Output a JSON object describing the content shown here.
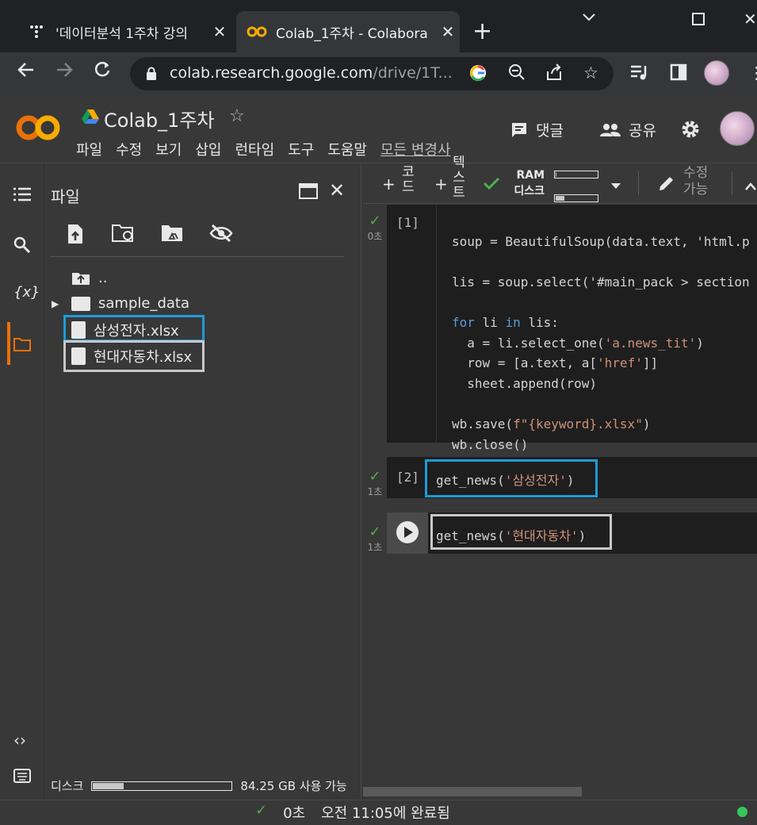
{
  "browser": {
    "tabs": [
      {
        "title": "'데이터분석 1주차 강의",
        "active": false
      },
      {
        "title": "Colab_1주차 - Colabora",
        "active": true
      }
    ],
    "url_host": "colab.research.google.com",
    "url_path": "/drive/1T..."
  },
  "colab": {
    "logo": "CO",
    "doc_title": "Colab_1주차",
    "menu": [
      "파일",
      "수정",
      "보기",
      "삽입",
      "런타임",
      "도구",
      "도움말",
      "모든 변경사"
    ],
    "comment_label": "댓글",
    "share_label": "공유"
  },
  "files_panel": {
    "title": "파일",
    "tree": [
      {
        "name": "..",
        "type": "parent"
      },
      {
        "name": "sample_data",
        "type": "folder"
      },
      {
        "name": "삼성전자.xlsx",
        "type": "file"
      },
      {
        "name": "현대자동차.xlsx",
        "type": "file"
      }
    ],
    "disk_label": "디스크",
    "disk_available": "84.25 GB 사용 가능",
    "disk_used_fraction": 0.22
  },
  "notebook_toolbar": {
    "add_code": "코드",
    "add_text": "텍스트",
    "ram_label": "RAM",
    "disk_label": "디스크",
    "ram_fraction": 0.02,
    "disk_fraction": 0.2,
    "edit_label": "수정 가능"
  },
  "cells": [
    {
      "prompt": "[1]",
      "status": "0초",
      "code": [
        "soup = BeautifulSoup(data.text, 'html.p",
        "",
        "lis = soup.select('#main_pack > section",
        "",
        "for li in lis:",
        "  a = li.select_one('a.news_tit')",
        "  row = [a.text, a['href']]",
        "  sheet.append(row)",
        "",
        "wb.save(f\"{keyword}.xlsx\")",
        "wb.close()"
      ]
    },
    {
      "prompt": "[2]",
      "status": "1초",
      "code": [
        "get_news('삼성전자')"
      ]
    },
    {
      "prompt": "",
      "status": "1초",
      "code": [
        "get_news('현대자동차')"
      ]
    }
  ],
  "status_bar": {
    "elapsed": "0초",
    "message": "오전 11:05에 완료됨"
  },
  "colors": {
    "highlight_blue": "#1e9bd7",
    "highlight_gray": "#c8c8c8",
    "colab_orange": "#f9ab00"
  }
}
